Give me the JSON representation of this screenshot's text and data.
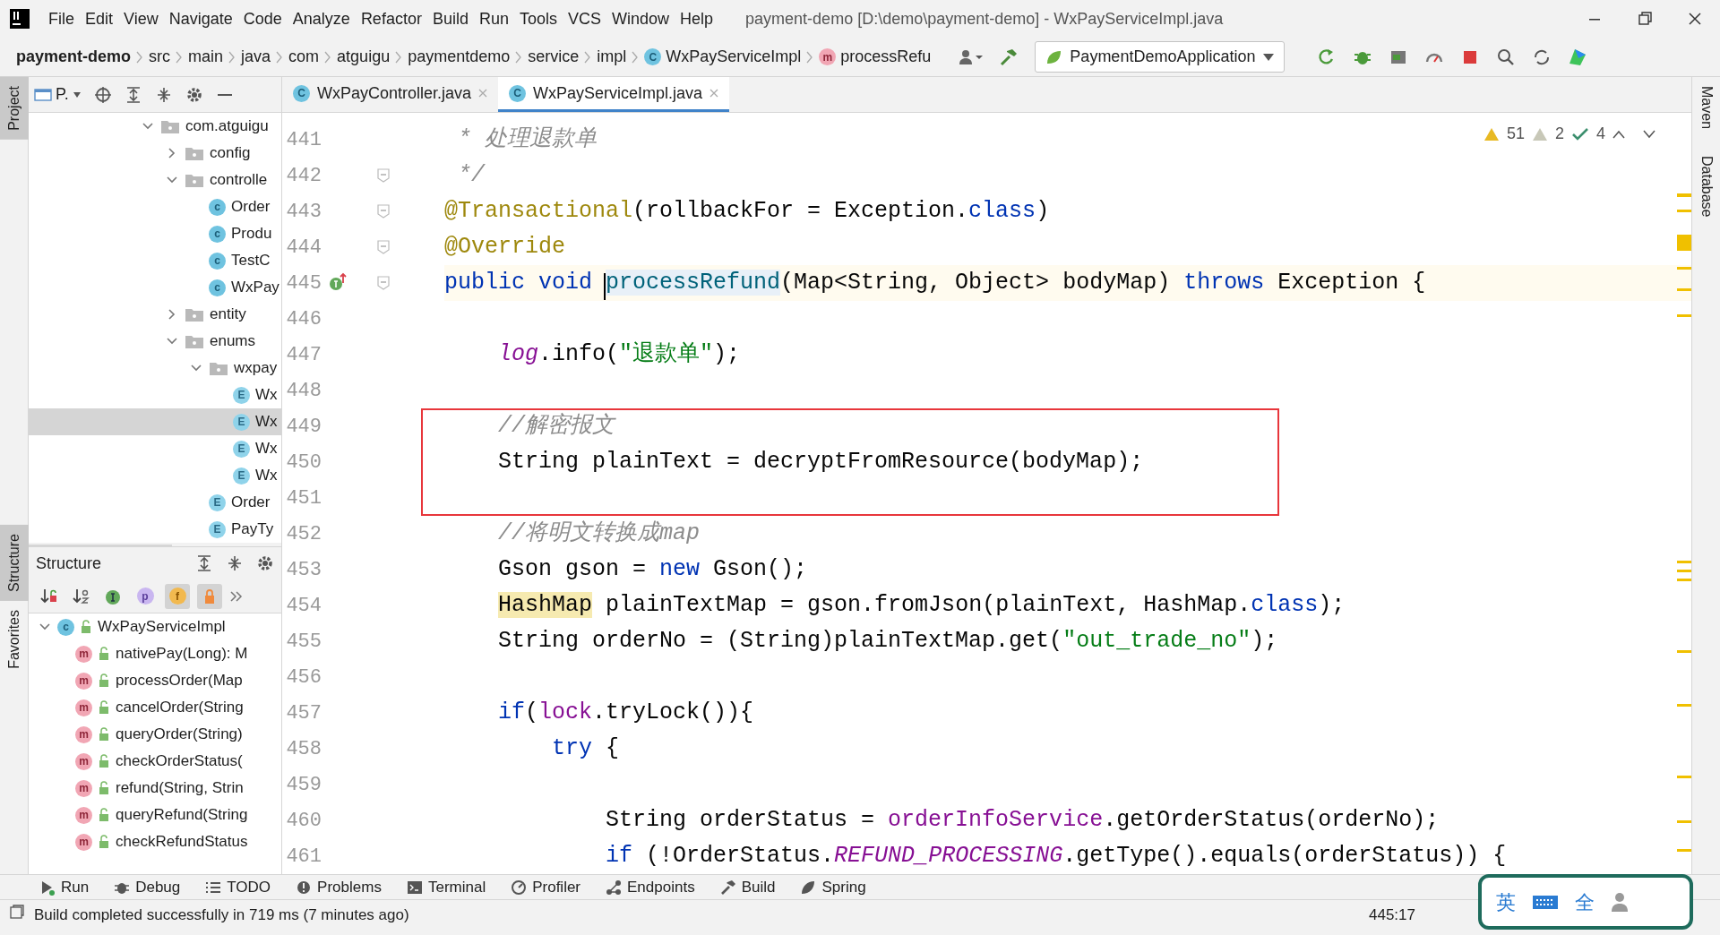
{
  "window": {
    "title": "payment-demo [D:\\demo\\payment-demo] - WxPayServiceImpl.java"
  },
  "menu": [
    "File",
    "Edit",
    "View",
    "Navigate",
    "Code",
    "Analyze",
    "Refactor",
    "Build",
    "Run",
    "Tools",
    "VCS",
    "Window",
    "Help"
  ],
  "breadcrumbs": [
    {
      "label": "payment-demo",
      "kind": "project"
    },
    {
      "label": "src",
      "kind": "dir"
    },
    {
      "label": "main",
      "kind": "dir"
    },
    {
      "label": "java",
      "kind": "dir"
    },
    {
      "label": "com",
      "kind": "dir"
    },
    {
      "label": "atguigu",
      "kind": "dir"
    },
    {
      "label": "paymentdemo",
      "kind": "dir"
    },
    {
      "label": "service",
      "kind": "dir"
    },
    {
      "label": "impl",
      "kind": "dir"
    },
    {
      "label": "WxPayServiceImpl",
      "kind": "class",
      "glyph": "C"
    },
    {
      "label": "processRefu",
      "kind": "method",
      "glyph": "m"
    }
  ],
  "run_config": "PaymentDemoApplication",
  "left_stripe": [
    {
      "label": "Project",
      "selected": true
    },
    {
      "label": "Structure",
      "selected": true
    },
    {
      "label": "Favorites",
      "selected": false
    }
  ],
  "right_stripe": [
    "Maven",
    "Database"
  ],
  "project_panel": {
    "title": "P.",
    "tree": [
      {
        "label": "com.atguigu",
        "kind": "folder",
        "expanded": true,
        "selected": false,
        "children": [
          {
            "label": "config",
            "kind": "folder",
            "expanded": false,
            "selected": false
          },
          {
            "label": "controlle",
            "kind": "folder",
            "expanded": true,
            "selected": false,
            "children": [
              {
                "label": "Order",
                "kind": "class",
                "glyph": "c",
                "selected": false
              },
              {
                "label": "Produ",
                "kind": "class",
                "glyph": "c",
                "selected": false
              },
              {
                "label": "TestC",
                "kind": "class",
                "glyph": "c",
                "selected": false
              },
              {
                "label": "WxPay",
                "kind": "class",
                "glyph": "c",
                "selected": false
              }
            ]
          },
          {
            "label": "entity",
            "kind": "folder",
            "expanded": false,
            "selected": false
          },
          {
            "label": "enums",
            "kind": "folder",
            "expanded": true,
            "selected": false,
            "children": [
              {
                "label": "wxpay",
                "kind": "folder",
                "expanded": true,
                "selected": false,
                "children": [
                  {
                    "label": "Wx",
                    "kind": "enum",
                    "glyph": "E",
                    "selected": false
                  },
                  {
                    "label": "Wx",
                    "kind": "enum",
                    "glyph": "E",
                    "selected": true
                  },
                  {
                    "label": "Wx",
                    "kind": "enum",
                    "glyph": "E",
                    "selected": false
                  },
                  {
                    "label": "Wx",
                    "kind": "enum",
                    "glyph": "E",
                    "selected": false
                  }
                ]
              },
              {
                "label": "Order",
                "kind": "enum",
                "glyph": "E",
                "selected": false
              },
              {
                "label": "PayTy",
                "kind": "enum",
                "glyph": "E",
                "selected": false
              }
            ]
          }
        ]
      }
    ]
  },
  "structure_panel": {
    "title": "Structure",
    "filters": [
      {
        "kind": "sort-visibility",
        "on": false
      },
      {
        "kind": "sort-alpha",
        "on": false
      },
      {
        "kind": "inherited",
        "on": false
      },
      {
        "kind": "properties",
        "glyph": "p",
        "on": false
      },
      {
        "kind": "fields",
        "glyph": "f",
        "on": true
      },
      {
        "kind": "non-public",
        "on": true
      }
    ],
    "tree": [
      {
        "label": "WxPayServiceImpl",
        "glyph": "c",
        "kind": "class",
        "expanded": true,
        "children": [
          {
            "label": "nativePay(Long): M",
            "glyph": "m",
            "kind": "method"
          },
          {
            "label": "processOrder(Map",
            "glyph": "m",
            "kind": "method"
          },
          {
            "label": "cancelOrder(String",
            "glyph": "m",
            "kind": "method"
          },
          {
            "label": "queryOrder(String)",
            "glyph": "m",
            "kind": "method"
          },
          {
            "label": "checkOrderStatus(",
            "glyph": "m",
            "kind": "method"
          },
          {
            "label": "refund(String, Strin",
            "glyph": "m",
            "kind": "method"
          },
          {
            "label": "queryRefund(String",
            "glyph": "m",
            "kind": "method"
          },
          {
            "label": "checkRefundStatus",
            "glyph": "m",
            "kind": "method"
          }
        ]
      }
    ]
  },
  "editor_tabs": [
    {
      "label": "WxPayController.java",
      "glyph": "C",
      "selected": false
    },
    {
      "label": "WxPayServiceImpl.java",
      "glyph": "C",
      "selected": true
    }
  ],
  "inspections": {
    "warnings": "51",
    "weak_warnings": "2",
    "typos": "4"
  },
  "editor_lines": [
    {
      "number": "441",
      "current": false,
      "boxed": false,
      "tokens": [
        {
          "kind": "cmt",
          "t": " * 处理退款单"
        }
      ]
    },
    {
      "number": "442",
      "gutter": {
        "kind": "fold"
      },
      "current": false,
      "boxed": false,
      "tokens": [
        {
          "kind": "cmt",
          "t": " */"
        }
      ]
    },
    {
      "number": "443",
      "gutter": {
        "kind": "fold"
      },
      "current": false,
      "boxed": false,
      "tokens": [
        {
          "kind": "ann",
          "t": "@Transactional"
        },
        {
          "kind": "p",
          "t": "(rollbackFor = Exception."
        },
        {
          "kind": "kw",
          "t": "class"
        },
        {
          "kind": "p",
          "t": ")"
        }
      ]
    },
    {
      "number": "444",
      "gutter": {
        "kind": "fold"
      },
      "current": false,
      "boxed": false,
      "tokens": [
        {
          "kind": "ann",
          "t": "@Override"
        }
      ]
    },
    {
      "number": "445",
      "gutter": {
        "kind": "implements"
      },
      "current": true,
      "boxed": false,
      "tokens": [
        {
          "kind": "kw",
          "t": "public void "
        },
        {
          "kind": "decl",
          "t": "processRefund"
        },
        {
          "kind": "p",
          "t": "(Map<String, Object> bodyMap) "
        },
        {
          "kind": "kw",
          "t": "throws"
        },
        {
          "kind": "p",
          "t": " Exception {"
        }
      ]
    },
    {
      "number": "446",
      "current": false,
      "boxed": false
    },
    {
      "number": "447",
      "current": false,
      "boxed": false,
      "tokens": [
        {
          "kind": "static",
          "t": "    log"
        },
        {
          "kind": "p",
          "t": ".info("
        },
        {
          "kind": "str",
          "t": "\"退款单\""
        },
        {
          "kind": "p",
          "t": ");"
        }
      ]
    },
    {
      "number": "448",
      "current": false,
      "boxed": false
    },
    {
      "number": "449",
      "current": false,
      "boxed": true,
      "tokens": [
        {
          "kind": "cmt",
          "t": "    //解密报文"
        }
      ]
    },
    {
      "number": "450",
      "current": false,
      "boxed": true,
      "tokens": [
        {
          "kind": "p",
          "t": "    String plainText = decryptFromResource(bodyMap);"
        }
      ]
    },
    {
      "number": "451",
      "current": false,
      "boxed": true
    },
    {
      "number": "452",
      "current": false,
      "boxed": false,
      "tokens": [
        {
          "kind": "cmt",
          "t": "    //将明文转换成map"
        }
      ]
    },
    {
      "number": "453",
      "current": false,
      "boxed": false,
      "tokens": [
        {
          "kind": "p",
          "t": "    Gson gson = "
        },
        {
          "kind": "kw",
          "t": "new"
        },
        {
          "kind": "p",
          "t": " Gson();"
        }
      ]
    },
    {
      "number": "454",
      "current": false,
      "boxed": false,
      "tokens": [
        {
          "kind": "warn",
          "t": "    HashMap"
        },
        {
          "kind": "p",
          "t": " plainTextMap = gson.fromJson(plainText, HashMap."
        },
        {
          "kind": "kw",
          "t": "class"
        },
        {
          "kind": "p",
          "t": ");"
        }
      ]
    },
    {
      "number": "455",
      "current": false,
      "boxed": false,
      "tokens": [
        {
          "kind": "p",
          "t": "    String orderNo = (String)plainTextMap.get("
        },
        {
          "kind": "str",
          "t": "\"out_trade_no\""
        },
        {
          "kind": "p",
          "t": ");"
        }
      ]
    },
    {
      "number": "456",
      "current": false,
      "boxed": false
    },
    {
      "number": "457",
      "current": false,
      "boxed": false,
      "tokens": [
        {
          "kind": "kw",
          "t": "    if"
        },
        {
          "kind": "p",
          "t": "("
        },
        {
          "kind": "field",
          "t": "lock"
        },
        {
          "kind": "p",
          "t": ".tryLock()){"
        }
      ]
    },
    {
      "number": "458",
      "current": false,
      "boxed": false,
      "tokens": [
        {
          "kind": "kw",
          "t": "        try"
        },
        {
          "kind": "p",
          "t": " {"
        }
      ]
    },
    {
      "number": "459",
      "current": false,
      "boxed": false
    },
    {
      "number": "460",
      "current": false,
      "boxed": false,
      "tokens": [
        {
          "kind": "p",
          "t": "            String orderStatus = "
        },
        {
          "kind": "field",
          "t": "orderInfoService"
        },
        {
          "kind": "p",
          "t": ".getOrderStatus(orderNo);"
        }
      ]
    },
    {
      "number": "461",
      "current": false,
      "boxed": false,
      "tokens": [
        {
          "kind": "kw",
          "t": "            if"
        },
        {
          "kind": "p",
          "t": " (!OrderStatus."
        },
        {
          "kind": "static",
          "t": "REFUND_PROCESSING"
        },
        {
          "kind": "p",
          "t": ".getType().equals(orderStatus)) {"
        }
      ]
    }
  ],
  "tool_windows": [
    {
      "label": "Run",
      "kind": "run"
    },
    {
      "label": "Debug",
      "kind": "debug"
    },
    {
      "label": "TODO",
      "kind": "todo"
    },
    {
      "label": "Problems",
      "kind": "problems"
    },
    {
      "label": "Terminal",
      "kind": "terminal"
    },
    {
      "label": "Profiler",
      "kind": "profiler"
    },
    {
      "label": "Endpoints",
      "kind": "endpoints"
    },
    {
      "label": "Build",
      "kind": "build"
    },
    {
      "label": "Spring",
      "kind": "spring"
    }
  ],
  "status_bar": {
    "message": "Build completed successfully in 719 ms (7 minutes ago)",
    "position": "445:17"
  },
  "ime_bar": {
    "mode": "英",
    "width": "全"
  }
}
